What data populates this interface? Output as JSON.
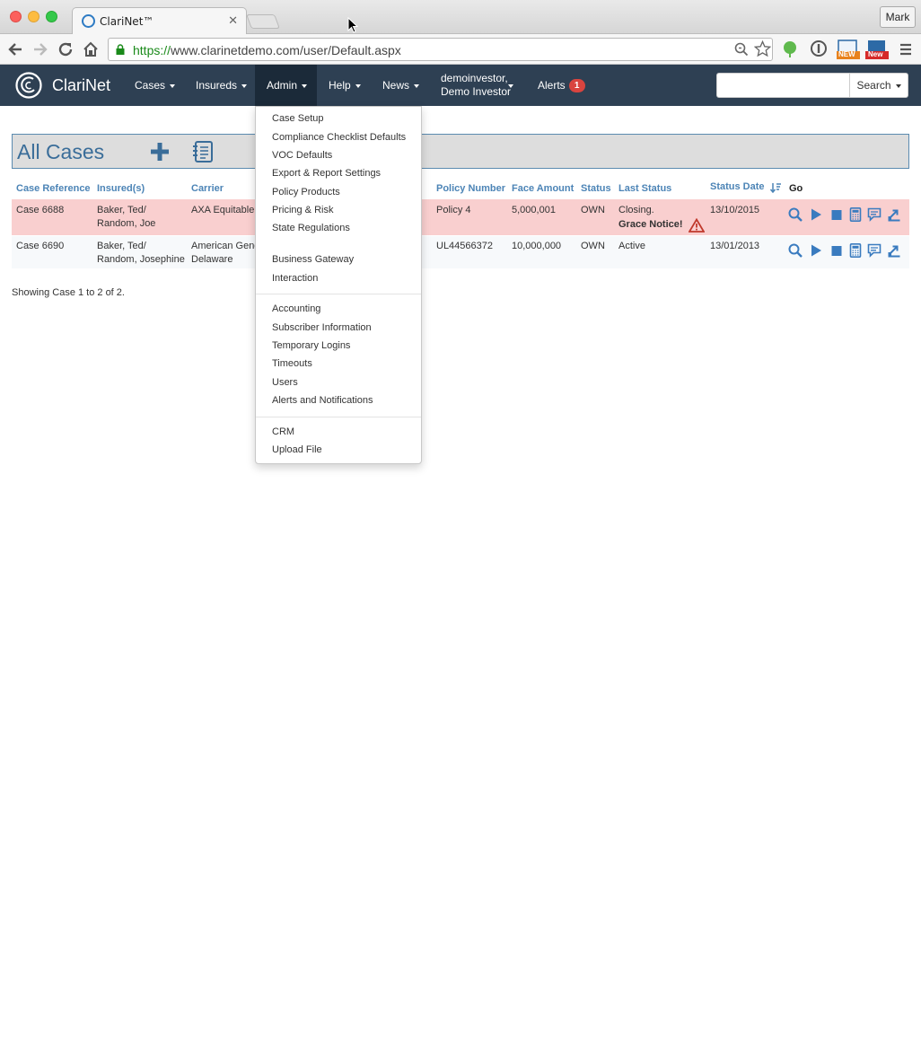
{
  "browser": {
    "tab_title": "ClariNet™",
    "profile_name": "Mark",
    "url_scheme": "https://",
    "url_rest": "www.clarinetdemo.com/user/Default.aspx",
    "ext_badges": [
      "NEW",
      "New"
    ]
  },
  "navbar": {
    "brand": "ClariNet",
    "menu": {
      "cases": "Cases",
      "insureds": "Insureds",
      "admin": "Admin",
      "help": "Help",
      "news": "News"
    },
    "user_line1": "demoinvestor,",
    "user_line2": "Demo Investor",
    "alerts_label": "Alerts",
    "alerts_count": "1",
    "search_label": "Search"
  },
  "admin_menu": {
    "items": [
      "Case Setup",
      "Compliance Checklist Defaults",
      "VOC Defaults",
      "Export & Report Settings",
      "Policy Products",
      "Pricing & Risk",
      "State Regulations",
      "Business Gateway",
      "Interaction",
      "Accounting",
      "Subscriber Information",
      "Temporary Logins",
      "Timeouts",
      "Users",
      "Alerts and Notifications",
      "CRM",
      "Upload File"
    ]
  },
  "page": {
    "title": "All Cases",
    "columns": {
      "case_reference": "Case Reference",
      "insureds": "Insured(s)",
      "carrier": "Carrier",
      "policy_number": "Policy Number",
      "face_amount": "Face Amount",
      "status": "Status",
      "last_status": "Last Status",
      "status_date": "Status Date",
      "go": "Go"
    },
    "rows": [
      {
        "case_reference": "Case 6688",
        "insured_1": "Baker, Ted/",
        "insured_2": "Random, Joe",
        "carrier_1": "AXA Equitable",
        "carrier_2": "",
        "policy_number": "Policy 4",
        "face_amount": "5,000,001",
        "status": "OWN",
        "last_status_1": "Closing.",
        "last_status_2": "Grace Notice!",
        "status_date": "13/10/2015"
      },
      {
        "case_reference": "Case 6690",
        "insured_1": "Baker, Ted/",
        "insured_2": "Random, Josephine",
        "carrier_1": "American Gene",
        "carrier_2": "Delaware",
        "policy_number": "UL44566372",
        "face_amount": "10,000,000",
        "status": "OWN",
        "last_status_1": "Active",
        "last_status_2": "",
        "status_date": "13/01/2013"
      }
    ],
    "footer": "Showing Case 1 to 2 of 2."
  },
  "colors": {
    "navbar_bg": "#2e4053",
    "header_blue": "#4c84b6",
    "icon_blue": "#3a7bbf",
    "row_alert_bg": "#f9cfcf",
    "badge_red": "#d9443f"
  }
}
